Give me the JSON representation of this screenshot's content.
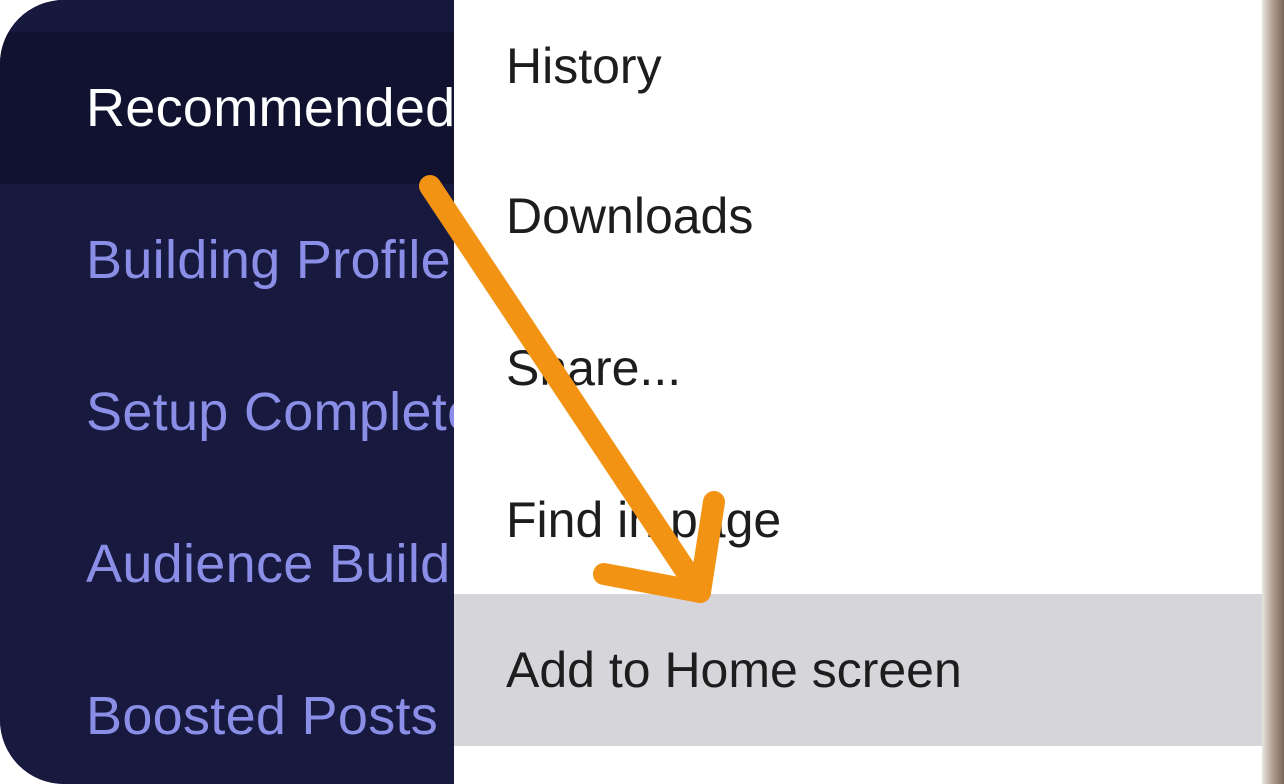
{
  "sidebar": {
    "items": [
      {
        "label": "Recommended",
        "active": true
      },
      {
        "label": "Building Profile",
        "active": false
      },
      {
        "label": "Setup Complete",
        "active": false
      },
      {
        "label": "Audience Building",
        "active": false
      },
      {
        "label": "Boosted Posts",
        "active": false
      }
    ]
  },
  "menu": {
    "items": [
      {
        "label": "History"
      },
      {
        "label": "Downloads"
      },
      {
        "label": "Share..."
      },
      {
        "label": "Find in page"
      },
      {
        "label": "Add to Home screen",
        "highlighted": true
      }
    ]
  },
  "annotation": {
    "arrow_color": "#f39314"
  },
  "colors": {
    "sidebar_bg": "#18193f",
    "sidebar_active_bg": "#111230",
    "sidebar_text": "#8b8ee6",
    "sidebar_active_text": "#ffffff",
    "menu_bg": "#ffffff",
    "menu_highlight_bg": "#d6d6da",
    "menu_text": "#1d1d1d"
  }
}
